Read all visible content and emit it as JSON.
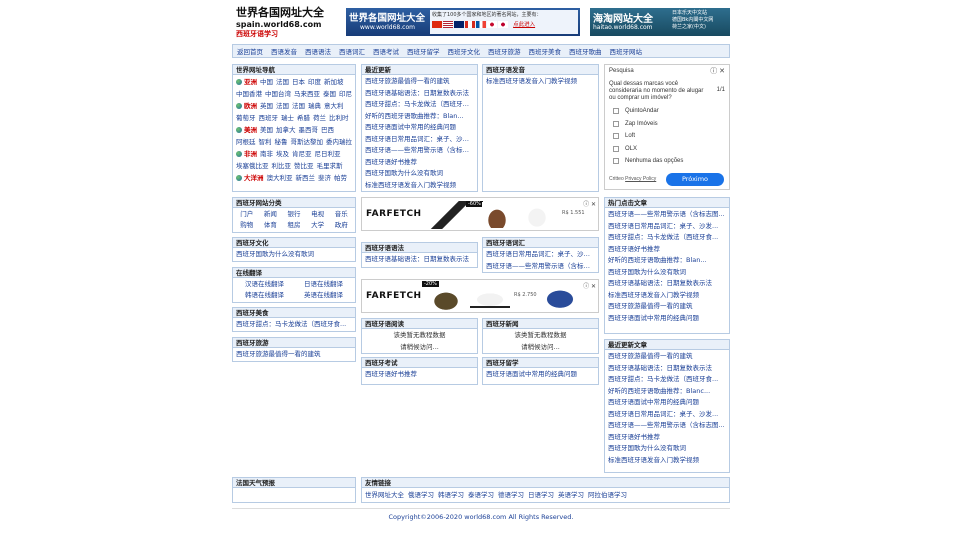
{
  "header": {
    "site_title": "世界各国网址大全",
    "site_domain": "spain.world68.com",
    "site_sub": "西班牙语学习",
    "banner1": {
      "title": "世界各国网址大全",
      "url": "www.world68.com",
      "text": "收集了100多个国家和地区的著名网站，主要有：",
      "link": "点此进入"
    },
    "banner2": {
      "title": "海淘网站大全",
      "url": "haitao.world68.com",
      "line1": "日本乐天中文站",
      "line2": "德国Bk内閣中文网",
      "line3": "荷兰之家(中文)"
    }
  },
  "nav": [
    "返回首页",
    "西语发音",
    "西语语法",
    "西语词汇",
    "西语考试",
    "西班牙留学",
    "西班牙文化",
    "西班牙旅游",
    "西班牙美食",
    "西班牙歌曲",
    "西班牙网站"
  ],
  "left": {
    "world_nav": {
      "title": "世界网址导航",
      "regions": [
        {
          "name": "亚洲",
          "items": [
            "中国",
            "法国",
            "日本",
            "印度",
            "新加坡"
          ]
        },
        {
          "name": "",
          "items": [
            "中国香港",
            "中国台湾",
            "马来西亚",
            "泰国",
            "印尼"
          ]
        },
        {
          "name": "欧洲",
          "items": [
            "英国",
            "法国",
            "法国",
            "瑞典",
            "意大利"
          ]
        },
        {
          "name": "",
          "items": [
            "葡萄牙",
            "西班牙",
            "瑞士",
            "希腊",
            "荷兰",
            "比利时"
          ]
        },
        {
          "name": "美洲",
          "items": [
            "美国",
            "加拿大",
            "墨西哥",
            "巴西"
          ]
        },
        {
          "name": "",
          "items": [
            "阿根廷",
            "智利",
            "秘鲁",
            "哥斯达黎加",
            "委内瑞拉"
          ]
        },
        {
          "name": "非洲",
          "items": [
            "南非",
            "埃及",
            "肯尼亚",
            "尼日利亚"
          ]
        },
        {
          "name": "",
          "items": [
            "埃塞俄比亚",
            "利比亚",
            "赞比亚",
            "毛里求斯"
          ]
        },
        {
          "name": "大洋洲",
          "items": [
            "澳大利亚",
            "新西兰",
            "斐济",
            "帕劳"
          ]
        }
      ]
    },
    "categories": {
      "title": "西班牙网站分类",
      "items": [
        "门户",
        "新闻",
        "银行",
        "电视",
        "音乐",
        "购物",
        "体育",
        "租房",
        "大学",
        "政府"
      ]
    },
    "culture": {
      "title": "西班牙文化",
      "items": [
        "西班牙国歌为什么没有歌词"
      ]
    },
    "translate": {
      "title": "在线翻译",
      "items": [
        "汉语在线翻译",
        "日语在线翻译",
        "韩语在线翻译",
        "英语在线翻译"
      ]
    },
    "food": {
      "title": "西班牙美食",
      "items": [
        "西班牙甜点：马卡龙做法（西班牙食..."
      ]
    },
    "travel": {
      "title": "西班牙旅游",
      "items": [
        "西班牙旅游最值得一看的建筑"
      ]
    },
    "weather": {
      "title": "法国天气预报"
    }
  },
  "middle": {
    "latest": {
      "title": "最近更新",
      "items": [
        "西班牙旅游最值得一看的建筑",
        "西班牙语基础语法：日期复数表示法",
        "西班牙甜点：马卡龙做法（西班牙食...",
        "好听的西班牙语歌曲推荐：Blan...",
        "西班牙语面试中常用的经典问题",
        "西班牙语日常用品词汇：桌子、沙发...",
        "西班牙语——些常用警示语（含标志图...",
        "西班牙语好书推荐",
        "西班牙国歌为什么没有歌词",
        "标准西班牙语发音入门教学视频"
      ]
    },
    "pronunciation": {
      "title": "西班牙语发音",
      "items": [
        "标准西班牙语发音入门教学视频"
      ]
    },
    "grammar": {
      "title": "西班牙语语法",
      "items": [
        "西班牙语基础语法：日期复数表示法"
      ]
    },
    "vocab": {
      "title": "西班牙语词汇",
      "items": [
        "西班牙语日常用品词汇：桌子、沙发...",
        "西班牙语——些常用警示语（含标志图..."
      ]
    },
    "reading": {
      "title": "西班牙语阅读",
      "items": [
        "该类暂无教程数据",
        "请稍候访问..."
      ]
    },
    "news": {
      "title": "西班牙新闻",
      "items": [
        "该类暂无教程数据",
        "请稍候访问..."
      ]
    },
    "exam": {
      "title": "西班牙考试",
      "items": [
        "西班牙语好书推荐"
      ]
    },
    "study": {
      "title": "西班牙留学",
      "items": [
        "西班牙语面试中常用的经典问题"
      ]
    },
    "links": {
      "title": "友情链接",
      "items": [
        "世界网址大全",
        "俄语学习",
        "韩语学习",
        "泰语学习",
        "德语学习",
        "日语学习",
        "英语学习",
        "阿拉伯语学习"
      ]
    },
    "ad1": {
      "brand": "FARFETCH",
      "badge": "-60%",
      "price": "R$ 1.551"
    },
    "ad2": {
      "brand": "FARFETCH",
      "badge": "-20%",
      "price": "R$ 2.750"
    }
  },
  "right": {
    "survey": {
      "label": "Pesquisa",
      "question": "Qual dessas marcas você consideraria no momento de alugar ou comprar um imóvel?",
      "page": "1/1",
      "options": [
        "QuintoAndar",
        "Zap Imóveis",
        "Loft",
        "OLX",
        "Nenhuma das opções"
      ],
      "footer_prefix": "Critteo",
      "footer_link": "Privacy Policy",
      "button": "Próximo"
    },
    "hot": {
      "title": "热门点击文章",
      "items": [
        "西班牙语——些常用警示语（含标志图...",
        "西班牙语日常用品词汇：桌子、沙发...",
        "西班牙甜点：马卡龙做法（西班牙食...",
        "西班牙语好书推荐",
        "好听的西班牙语歌曲推荐：Blan...",
        "西班牙国歌为什么没有歌词",
        "西班牙语基础语法：日期复数表示法",
        "标准西班牙语发音入门教学视频",
        "西班牙旅游最值得一看的建筑",
        "西班牙语面试中常用的经典问题"
      ]
    },
    "recent": {
      "title": "最近更新文章",
      "items": [
        "西班牙旅游最值得一看的建筑",
        "西班牙语基础语法：日期复数表示法",
        "西班牙甜点：马卡龙做法（西班牙食...",
        "好听的西班牙语歌曲推荐：Blanc...",
        "西班牙语面试中常用的经典问题",
        "西班牙语日常用品词汇：桌子、沙发...",
        "西班牙语——些常用警示语（含标志图...",
        "西班牙语好书推荐",
        "西班牙国歌为什么没有歌词",
        "标准西班牙语发音入门教学视频"
      ]
    }
  },
  "footer": "Copyright©2006-2020  world68.com  All Rights Reserved."
}
